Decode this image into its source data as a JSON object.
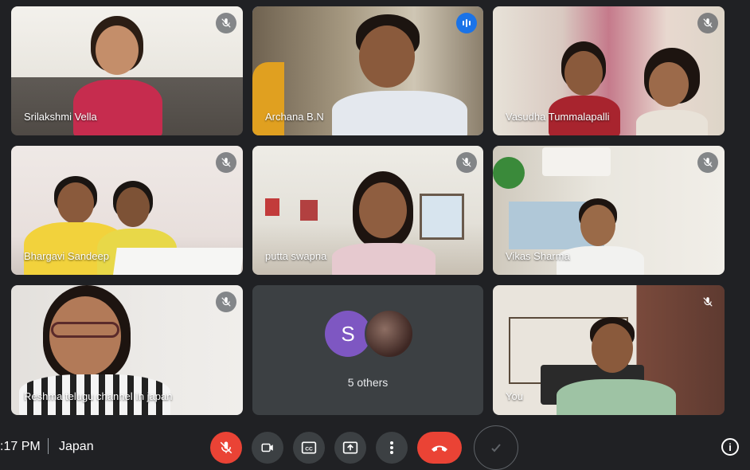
{
  "participants": [
    {
      "name": "Srilakshmi Vella",
      "muted": true
    },
    {
      "name": "Archana B.N",
      "muted": false,
      "speaking": true
    },
    {
      "name": "Vasudha Tummalapalli",
      "muted": true
    },
    {
      "name": "Bhargavi Sandeep",
      "muted": true
    },
    {
      "name": "putta swapna",
      "muted": true
    },
    {
      "name": "Vikas Sharma",
      "muted": true
    },
    {
      "name": "Reshma telugu channel In japan",
      "muted": true
    },
    {
      "name": "You",
      "muted": true
    }
  ],
  "others": {
    "avatar_letter": "S",
    "label": "5 others"
  },
  "bottom_bar": {
    "time": ":17 PM",
    "meeting_name": "Japan",
    "info_label": "i"
  },
  "colors": {
    "background": "#202124",
    "tile": "#3c4043",
    "speaking_outline": "#5b8ff0",
    "end_call": "#ea4335",
    "avatar_s": "#7e57c2"
  },
  "icons": [
    "mic-off-icon",
    "audio-level-icon",
    "camera-icon",
    "captions-icon",
    "present-icon",
    "more-options-icon",
    "end-call-icon",
    "check-icon",
    "info-icon"
  ]
}
